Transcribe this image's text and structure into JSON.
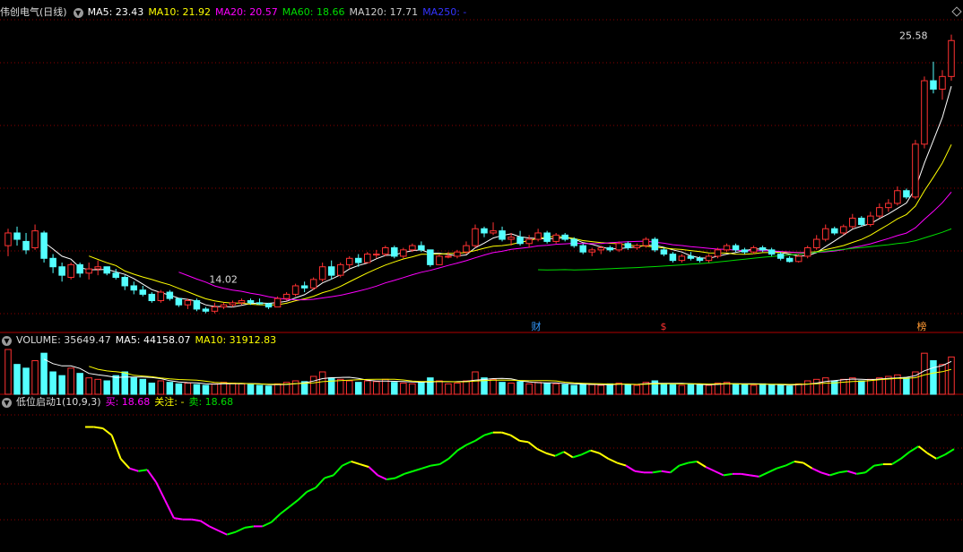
{
  "main": {
    "title": "伟创电气(日线)",
    "ma5": "MA5: 23.43",
    "ma10": "MA10: 21.92",
    "ma20": "MA20: 20.57",
    "ma60": "MA60: 18.66",
    "ma120": "MA120: 17.71",
    "ma250": "MA250: -",
    "high_label": "25.58",
    "low_label": "14.02",
    "markers": [
      "财",
      "$",
      "榜"
    ]
  },
  "volume": {
    "label": "VOLUME: 35649.47",
    "ma5": "MA5: 44158.07",
    "ma10": "MA10: 31912.83"
  },
  "indicator": {
    "name": "低位启动1(10,9,3)",
    "buy": "买: 18.68",
    "watch": "关注: -",
    "sell": "卖: 18.68"
  },
  "colors": {
    "up": "#ff3232",
    "down": "#54ffff",
    "ma5": "#ffffff",
    "ma10": "#ffff00",
    "ma20": "#ff00ff",
    "ma60": "#00dd00",
    "ma120": "#cccccc",
    "ma250": "#3333ff",
    "grid": "#8b0000"
  },
  "chart_data": {
    "type": "candlestick",
    "period": "daily",
    "candles": [
      [
        15.6,
        16.4,
        15.1,
        16.2
      ],
      [
        16.2,
        16.5,
        15.6,
        15.9
      ],
      [
        15.8,
        16.2,
        15.2,
        15.4
      ],
      [
        15.5,
        16.6,
        15.4,
        16.3
      ],
      [
        16.2,
        16.3,
        14.8,
        15.0
      ],
      [
        15.0,
        15.2,
        14.3,
        14.6
      ],
      [
        14.6,
        14.8,
        13.9,
        14.2
      ],
      [
        14.1,
        14.8,
        14.0,
        14.7
      ],
      [
        14.7,
        14.8,
        14.1,
        14.3
      ],
      [
        14.3,
        14.8,
        14.0,
        14.5
      ],
      [
        14.5,
        14.9,
        14.2,
        14.6
      ],
      [
        14.6,
        14.6,
        14.2,
        14.3
      ],
      [
        14.3,
        14.5,
        14.0,
        14.1
      ],
      [
        14.1,
        14.2,
        13.5,
        13.7
      ],
      [
        13.7,
        13.9,
        13.3,
        13.5
      ],
      [
        13.5,
        13.7,
        13.2,
        13.3
      ],
      [
        13.3,
        13.4,
        12.9,
        13.0
      ],
      [
        13.0,
        13.5,
        12.9,
        13.4
      ],
      [
        13.4,
        13.5,
        13.0,
        13.1
      ],
      [
        13.1,
        13.1,
        12.7,
        12.8
      ],
      [
        12.8,
        13.1,
        12.6,
        13.0
      ],
      [
        13.0,
        13.1,
        12.5,
        12.6
      ],
      [
        12.6,
        12.7,
        12.4,
        12.5
      ],
      [
        12.5,
        12.9,
        12.4,
        12.7
      ],
      [
        12.7,
        12.9,
        12.6,
        12.8
      ],
      [
        12.8,
        13.0,
        12.7,
        12.9
      ],
      [
        12.9,
        13.1,
        12.8,
        13.0
      ],
      [
        13.0,
        13.1,
        12.8,
        12.9
      ],
      [
        12.9,
        13.1,
        12.8,
        12.85
      ],
      [
        12.85,
        12.9,
        12.6,
        12.7
      ],
      [
        12.7,
        13.2,
        12.7,
        13.1
      ],
      [
        13.1,
        13.4,
        13.0,
        13.3
      ],
      [
        13.3,
        13.8,
        13.2,
        13.7
      ],
      [
        13.7,
        13.9,
        13.4,
        13.6
      ],
      [
        13.6,
        14.1,
        13.5,
        14.0
      ],
      [
        14.0,
        14.8,
        13.9,
        14.6
      ],
      [
        14.6,
        14.9,
        14.0,
        14.2
      ],
      [
        14.2,
        14.8,
        14.1,
        14.7
      ],
      [
        14.7,
        15.1,
        14.5,
        15.0
      ],
      [
        15.0,
        15.2,
        14.6,
        14.8
      ],
      [
        14.8,
        15.3,
        14.8,
        15.2
      ],
      [
        15.2,
        15.4,
        15.0,
        15.2
      ],
      [
        15.2,
        15.6,
        15.1,
        15.5
      ],
      [
        15.5,
        15.6,
        15.0,
        15.1
      ],
      [
        15.1,
        15.5,
        15.0,
        15.4
      ],
      [
        15.4,
        15.7,
        15.3,
        15.6
      ],
      [
        15.6,
        15.8,
        15.3,
        15.4
      ],
      [
        15.4,
        15.4,
        14.6,
        14.7
      ],
      [
        14.7,
        15.2,
        14.7,
        15.1
      ],
      [
        15.1,
        15.3,
        15.0,
        15.1
      ],
      [
        15.1,
        15.4,
        15.0,
        15.3
      ],
      [
        15.3,
        15.8,
        15.2,
        15.6
      ],
      [
        15.6,
        16.6,
        15.5,
        16.4
      ],
      [
        16.4,
        16.5,
        16.0,
        16.2
      ],
      [
        16.2,
        16.7,
        16.1,
        16.3
      ],
      [
        16.3,
        16.5,
        15.8,
        15.9
      ],
      [
        15.9,
        16.2,
        15.6,
        16.0
      ],
      [
        16.0,
        16.3,
        15.6,
        15.7
      ],
      [
        15.7,
        16.1,
        15.5,
        15.9
      ],
      [
        15.9,
        16.4,
        15.8,
        16.2
      ],
      [
        16.2,
        16.3,
        15.7,
        15.8
      ],
      [
        15.8,
        16.2,
        15.7,
        16.1
      ],
      [
        16.1,
        16.2,
        15.8,
        15.9
      ],
      [
        15.9,
        16.0,
        15.5,
        15.6
      ],
      [
        15.6,
        15.7,
        15.2,
        15.3
      ],
      [
        15.3,
        15.5,
        15.1,
        15.4
      ],
      [
        15.4,
        15.6,
        15.2,
        15.5
      ],
      [
        15.5,
        15.6,
        15.3,
        15.4
      ],
      [
        15.4,
        15.8,
        15.3,
        15.7
      ],
      [
        15.7,
        15.8,
        15.4,
        15.5
      ],
      [
        15.5,
        15.7,
        15.4,
        15.6
      ],
      [
        15.6,
        16.0,
        15.5,
        15.9
      ],
      [
        15.9,
        16.0,
        15.3,
        15.4
      ],
      [
        15.4,
        15.5,
        15.1,
        15.2
      ],
      [
        15.2,
        15.3,
        14.8,
        14.9
      ],
      [
        14.9,
        15.2,
        14.8,
        15.1
      ],
      [
        15.1,
        15.3,
        14.9,
        15.0
      ],
      [
        15.0,
        15.1,
        14.8,
        14.9
      ],
      [
        14.9,
        15.2,
        14.8,
        15.1
      ],
      [
        15.1,
        15.5,
        15.0,
        15.4
      ],
      [
        15.4,
        15.7,
        15.3,
        15.6
      ],
      [
        15.6,
        15.7,
        15.3,
        15.4
      ],
      [
        15.4,
        15.5,
        15.2,
        15.3
      ],
      [
        15.3,
        15.6,
        15.2,
        15.5
      ],
      [
        15.5,
        15.6,
        15.3,
        15.4
      ],
      [
        15.4,
        15.5,
        15.1,
        15.2
      ],
      [
        15.2,
        15.3,
        14.9,
        15.0
      ],
      [
        15.0,
        15.1,
        14.8,
        14.85
      ],
      [
        14.85,
        15.2,
        14.8,
        15.1
      ],
      [
        15.1,
        15.6,
        15.0,
        15.5
      ],
      [
        15.5,
        16.1,
        15.4,
        15.9
      ],
      [
        15.9,
        16.6,
        15.8,
        16.4
      ],
      [
        16.4,
        16.5,
        16.1,
        16.2
      ],
      [
        16.2,
        16.6,
        16.1,
        16.5
      ],
      [
        16.5,
        17.1,
        16.4,
        16.9
      ],
      [
        16.9,
        17.0,
        16.5,
        16.6
      ],
      [
        16.6,
        17.2,
        16.5,
        17.0
      ],
      [
        17.0,
        17.6,
        16.9,
        17.4
      ],
      [
        17.4,
        17.8,
        17.2,
        17.6
      ],
      [
        17.6,
        18.4,
        17.5,
        18.2
      ],
      [
        18.2,
        18.3,
        17.8,
        17.9
      ],
      [
        17.9,
        20.6,
        17.8,
        20.4
      ],
      [
        20.4,
        23.6,
        20.2,
        23.4
      ],
      [
        23.4,
        24.3,
        22.8,
        23.0
      ],
      [
        23.0,
        23.9,
        22.5,
        23.6
      ],
      [
        23.6,
        25.58,
        23.4,
        25.3
      ]
    ],
    "volume": [
      60,
      40,
      35,
      45,
      55,
      30,
      25,
      35,
      28,
      22,
      20,
      18,
      25,
      30,
      22,
      20,
      15,
      18,
      16,
      14,
      15,
      13,
      12,
      14,
      16,
      15,
      14,
      13,
      12,
      11,
      14,
      16,
      18,
      17,
      24,
      30,
      22,
      20,
      18,
      16,
      18,
      17,
      20,
      16,
      15,
      14,
      16,
      22,
      18,
      14,
      15,
      18,
      30,
      22,
      20,
      16,
      15,
      17,
      14,
      16,
      15,
      14,
      13,
      12,
      14,
      13,
      12,
      14,
      15,
      13,
      12,
      16,
      18,
      14,
      13,
      12,
      14,
      13,
      12,
      15,
      16,
      14,
      13,
      12,
      14,
      13,
      12,
      11,
      14,
      18,
      20,
      22,
      18,
      20,
      22,
      18,
      20,
      22,
      24,
      26,
      22,
      30,
      55,
      45,
      40,
      50
    ],
    "vol_max": 60,
    "price_range": [
      12.3,
      26.2
    ],
    "indicator": [
      88,
      88,
      87,
      82,
      65,
      58,
      56,
      57,
      48,
      35,
      22,
      21,
      21,
      20,
      16,
      13,
      10,
      12,
      15,
      16,
      16,
      19,
      25,
      30,
      35,
      41,
      44,
      51,
      53,
      60,
      63,
      61,
      59,
      53,
      50,
      51,
      54,
      56,
      58,
      60,
      61,
      65,
      71,
      75,
      78,
      82,
      84,
      84,
      82,
      78,
      77,
      72,
      69,
      67,
      70,
      66,
      68,
      71,
      69,
      65,
      62,
      60,
      56,
      55,
      55,
      56,
      55,
      60,
      62,
      63,
      59,
      56,
      53,
      54,
      54,
      53,
      52,
      55,
      58,
      60,
      63,
      62,
      58,
      55,
      53,
      55,
      56,
      54,
      55,
      60,
      61,
      61,
      65,
      70,
      74,
      69,
      65,
      68,
      72
    ],
    "indicator_range": [
      0,
      100
    ],
    "annotations": {
      "high": 25.58,
      "low": 14.02
    }
  }
}
